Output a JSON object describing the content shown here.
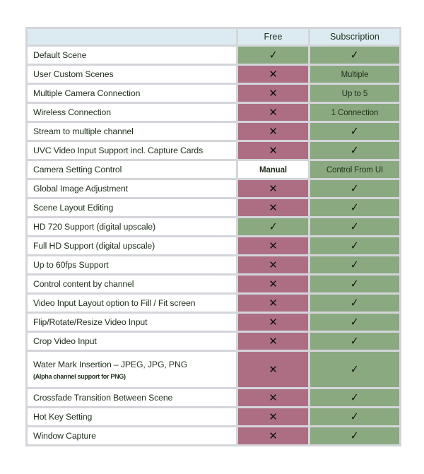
{
  "table": {
    "columns": [
      "",
      "Free",
      "Subscription"
    ],
    "rows": [
      {
        "feature": "Default Scene",
        "note": "",
        "free": {
          "type": "check"
        },
        "sub": {
          "type": "check"
        }
      },
      {
        "feature": "User Custom Scenes",
        "note": "",
        "free": {
          "type": "cross"
        },
        "sub": {
          "type": "text",
          "value": "Multiple"
        }
      },
      {
        "feature": "Multiple Camera Connection",
        "note": "",
        "free": {
          "type": "cross"
        },
        "sub": {
          "type": "text",
          "value": "Up to 5"
        }
      },
      {
        "feature": "Wireless Connection",
        "note": "",
        "free": {
          "type": "cross"
        },
        "sub": {
          "type": "text",
          "value": "1 Connection"
        }
      },
      {
        "feature": "Stream to multiple channel",
        "note": "",
        "free": {
          "type": "cross"
        },
        "sub": {
          "type": "check"
        }
      },
      {
        "feature": "UVC Video Input Support incl. Capture Cards",
        "note": "",
        "free": {
          "type": "cross"
        },
        "sub": {
          "type": "check"
        }
      },
      {
        "feature": "Camera Setting Control",
        "note": "",
        "free": {
          "type": "plain",
          "value": "Manual"
        },
        "sub": {
          "type": "text",
          "value": "Control From UI"
        }
      },
      {
        "feature": "Global Image Adjustment",
        "note": "",
        "free": {
          "type": "cross"
        },
        "sub": {
          "type": "check"
        }
      },
      {
        "feature": "Scene Layout Editing",
        "note": "",
        "free": {
          "type": "cross"
        },
        "sub": {
          "type": "check"
        }
      },
      {
        "feature": "HD 720 Support (digital upscale)",
        "note": "",
        "free": {
          "type": "check"
        },
        "sub": {
          "type": "check"
        }
      },
      {
        "feature": "Full HD Support (digital upscale)",
        "note": "",
        "free": {
          "type": "cross"
        },
        "sub": {
          "type": "check"
        }
      },
      {
        "feature": "Up to 60fps Support",
        "note": "",
        "free": {
          "type": "cross"
        },
        "sub": {
          "type": "check"
        }
      },
      {
        "feature": "Control content by channel",
        "note": "",
        "free": {
          "type": "cross"
        },
        "sub": {
          "type": "check"
        }
      },
      {
        "feature": "Video Input Layout option to Fill / Fit screen",
        "note": "",
        "free": {
          "type": "cross"
        },
        "sub": {
          "type": "check"
        }
      },
      {
        "feature": "Flip/Rotate/Resize Video Input",
        "note": "",
        "free": {
          "type": "cross"
        },
        "sub": {
          "type": "check"
        }
      },
      {
        "feature": "Crop Video Input",
        "note": "",
        "free": {
          "type": "cross"
        },
        "sub": {
          "type": "check"
        }
      },
      {
        "feature": "Water Mark Insertion – JPEG, JPG, PNG",
        "note": "(Alpha channel support for PNG)",
        "tall": true,
        "free": {
          "type": "cross"
        },
        "sub": {
          "type": "check"
        }
      },
      {
        "feature": "Crossfade Transition Between Scene",
        "note": "",
        "free": {
          "type": "cross"
        },
        "sub": {
          "type": "check"
        }
      },
      {
        "feature": "Hot Key Setting",
        "note": "",
        "free": {
          "type": "cross"
        },
        "sub": {
          "type": "check"
        }
      },
      {
        "feature": "Window Capture",
        "note": "",
        "free": {
          "type": "cross"
        },
        "sub": {
          "type": "check"
        }
      }
    ]
  },
  "glyphs": {
    "check": "✓",
    "cross": "✕"
  },
  "colors": {
    "header_bg": "#dcebf2",
    "yes_bg": "#8aa980",
    "no_bg": "#ad6e84",
    "plain_bg": "#ffffff",
    "gutter": "#d4d5da",
    "text": "#23321f"
  }
}
